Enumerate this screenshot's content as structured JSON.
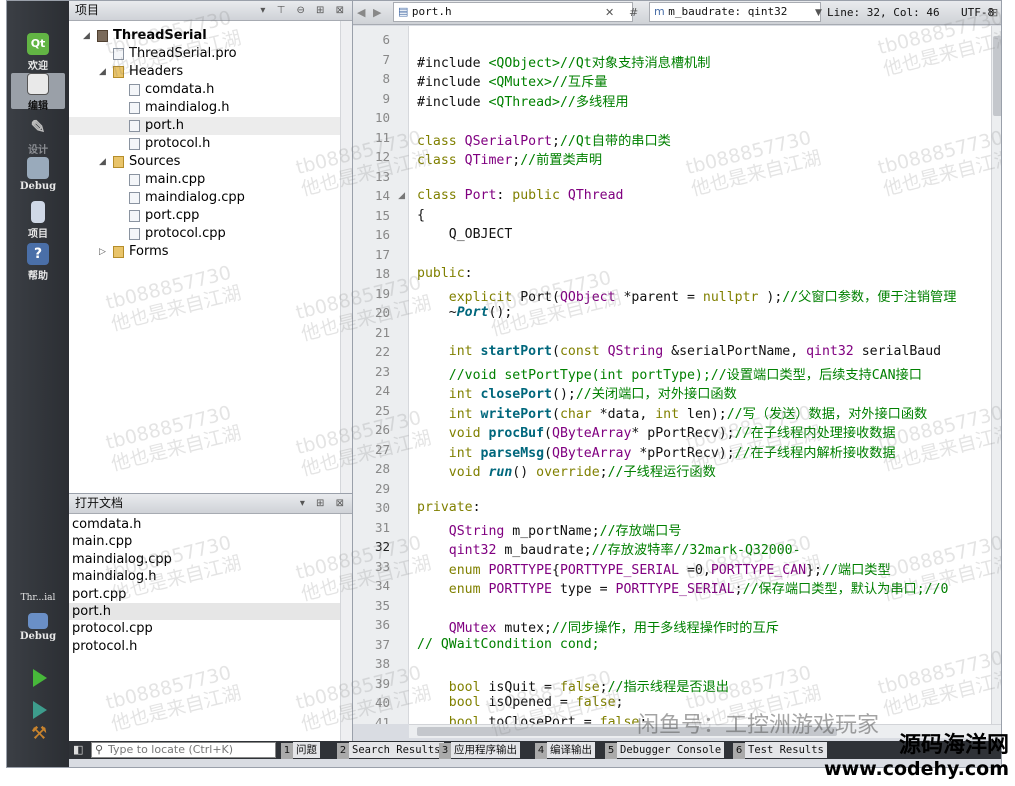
{
  "modes": [
    {
      "label": "欢迎",
      "icon": "qt-logo-icon",
      "icon_text": "Qt"
    },
    {
      "label": "编辑",
      "icon": "edit-document-icon",
      "active": true
    },
    {
      "label": "设计",
      "icon": "design-pen-icon"
    },
    {
      "label": "Debug",
      "icon": "debug-bug-icon"
    },
    {
      "label": "项目",
      "icon": "project-wrench-icon"
    },
    {
      "label": "帮助",
      "icon": "help-icon",
      "icon_text": "?"
    }
  ],
  "kit": {
    "label": "Thr...ial",
    "config": "Debug"
  },
  "project_pane": {
    "title": "项目",
    "tree": [
      {
        "label": "ThreadSerial",
        "level": 0,
        "expanded": true,
        "kind": "project"
      },
      {
        "label": "ThreadSerial.pro",
        "level": 1,
        "kind": "file"
      },
      {
        "label": "Headers",
        "level": 1,
        "expanded": true,
        "kind": "folder"
      },
      {
        "label": "comdata.h",
        "level": 2,
        "kind": "file"
      },
      {
        "label": "maindialog.h",
        "level": 2,
        "kind": "file"
      },
      {
        "label": "port.h",
        "level": 2,
        "kind": "file",
        "selected": true
      },
      {
        "label": "protocol.h",
        "level": 2,
        "kind": "file"
      },
      {
        "label": "Sources",
        "level": 1,
        "expanded": true,
        "kind": "folder"
      },
      {
        "label": "main.cpp",
        "level": 2,
        "kind": "file"
      },
      {
        "label": "maindialog.cpp",
        "level": 2,
        "kind": "file"
      },
      {
        "label": "port.cpp",
        "level": 2,
        "kind": "file"
      },
      {
        "label": "protocol.cpp",
        "level": 2,
        "kind": "file"
      },
      {
        "label": "Forms",
        "level": 1,
        "expanded": false,
        "kind": "folder"
      }
    ]
  },
  "open_docs": {
    "title": "打开文档",
    "items": [
      "comdata.h",
      "main.cpp",
      "maindialog.cpp",
      "maindialog.h",
      "port.cpp",
      "port.h",
      "protocol.cpp",
      "protocol.h"
    ],
    "selected": "port.h"
  },
  "editor": {
    "file": "port.h",
    "symbol": "m_baudrate: qint32",
    "position": "Line: 32, Col: 46",
    "encoding": "UTF-8"
  },
  "code_lines": [
    {
      "n": "6",
      "segs": []
    },
    {
      "n": "7",
      "segs": [
        [
          "",
          "#include "
        ],
        [
          "str",
          "<QObject>"
        ],
        [
          "cm",
          "//Qt对象支持消息槽机制"
        ]
      ]
    },
    {
      "n": "8",
      "segs": [
        [
          "",
          "#include "
        ],
        [
          "str",
          "<QMutex>"
        ],
        [
          "cm",
          "//互斥量"
        ]
      ]
    },
    {
      "n": "9",
      "segs": [
        [
          "",
          "#include "
        ],
        [
          "str",
          "<QThread>"
        ],
        [
          "cm",
          "//多线程用"
        ]
      ]
    },
    {
      "n": "10",
      "segs": []
    },
    {
      "n": "11",
      "segs": [
        [
          "kw",
          "class "
        ],
        [
          "type",
          "QSerialPort"
        ],
        [
          "",
          ";"
        ],
        [
          "cm",
          "//Qt自带的串口类"
        ]
      ]
    },
    {
      "n": "12",
      "segs": [
        [
          "kw",
          "class "
        ],
        [
          "type",
          "QTimer"
        ],
        [
          "",
          ";"
        ],
        [
          "cm",
          "//前置类声明"
        ]
      ]
    },
    {
      "n": "13",
      "segs": []
    },
    {
      "n": "14",
      "fold": true,
      "segs": [
        [
          "kw",
          "class "
        ],
        [
          "type",
          "Port"
        ],
        [
          "",
          ": "
        ],
        [
          "kw",
          "public "
        ],
        [
          "type",
          "QThread"
        ]
      ]
    },
    {
      "n": "15",
      "segs": [
        [
          "",
          "{"
        ]
      ]
    },
    {
      "n": "16",
      "segs": [
        [
          "",
          "    Q_OBJECT"
        ]
      ]
    },
    {
      "n": "17",
      "segs": []
    },
    {
      "n": "18",
      "segs": [
        [
          "kw",
          "public"
        ],
        [
          "",
          ":"
        ]
      ]
    },
    {
      "n": "19",
      "segs": [
        [
          "",
          "    "
        ],
        [
          "kw",
          "explicit "
        ],
        [
          "",
          "Port("
        ],
        [
          "type",
          "QObject "
        ],
        [
          "",
          "*parent = "
        ],
        [
          "kw",
          "nullptr"
        ],
        [
          "",
          " );"
        ],
        [
          "cm",
          "//父窗口参数，便于注销管理"
        ]
      ]
    },
    {
      "n": "20",
      "segs": [
        [
          "",
          "    ~"
        ],
        [
          "fni",
          "Port"
        ],
        [
          "",
          "();"
        ]
      ]
    },
    {
      "n": "21",
      "segs": []
    },
    {
      "n": "22",
      "segs": [
        [
          "",
          "    "
        ],
        [
          "kw",
          "int "
        ],
        [
          "fn",
          "startPort"
        ],
        [
          "",
          "("
        ],
        [
          "kw",
          "const "
        ],
        [
          "type",
          "QString "
        ],
        [
          "",
          "&serialPortName, "
        ],
        [
          "type",
          "qint32 "
        ],
        [
          "",
          "serialBaud"
        ]
      ]
    },
    {
      "n": "23",
      "segs": [
        [
          "",
          "    "
        ],
        [
          "cm",
          "//void setPortType(int portType);//设置端口类型，后续支持CAN接口"
        ]
      ]
    },
    {
      "n": "24",
      "segs": [
        [
          "",
          "    "
        ],
        [
          "kw",
          "int "
        ],
        [
          "fn",
          "closePort"
        ],
        [
          "",
          "();"
        ],
        [
          "cm",
          "//关闭端口，对外接口函数"
        ]
      ]
    },
    {
      "n": "25",
      "segs": [
        [
          "",
          "    "
        ],
        [
          "kw",
          "int "
        ],
        [
          "fn",
          "writePort"
        ],
        [
          "",
          "("
        ],
        [
          "kw",
          "char "
        ],
        [
          "",
          "*data, "
        ],
        [
          "kw",
          "int "
        ],
        [
          "",
          "len);"
        ],
        [
          "cm",
          "//写（发送）数据，对外接口函数"
        ]
      ]
    },
    {
      "n": "26",
      "segs": [
        [
          "",
          "    "
        ],
        [
          "kw",
          "void "
        ],
        [
          "fn",
          "procBuf"
        ],
        [
          "",
          "("
        ],
        [
          "type",
          "QByteArray"
        ],
        [
          "",
          "* pPortRecv);"
        ],
        [
          "cm",
          "//在子线程内处理接收数据"
        ]
      ]
    },
    {
      "n": "27",
      "segs": [
        [
          "",
          "    "
        ],
        [
          "kw",
          "int "
        ],
        [
          "fn",
          "parseMsg"
        ],
        [
          "",
          "("
        ],
        [
          "type",
          "QByteArray "
        ],
        [
          "",
          "*pPortRecv);"
        ],
        [
          "cm",
          "//在子线程内解析接收数据"
        ]
      ]
    },
    {
      "n": "28",
      "segs": [
        [
          "",
          "    "
        ],
        [
          "kw",
          "void "
        ],
        [
          "fni",
          "run"
        ],
        [
          "",
          "() "
        ],
        [
          "kw",
          "override"
        ],
        [
          "",
          ";"
        ],
        [
          "cm",
          "//子线程运行函数"
        ]
      ]
    },
    {
      "n": "29",
      "segs": []
    },
    {
      "n": "30",
      "segs": [
        [
          "kw",
          "private"
        ],
        [
          "",
          ":"
        ]
      ]
    },
    {
      "n": "31",
      "segs": [
        [
          "",
          "    "
        ],
        [
          "type",
          "QString "
        ],
        [
          "",
          "m_portName;"
        ],
        [
          "cm",
          "//存放端口号"
        ]
      ]
    },
    {
      "n": "32",
      "current": true,
      "segs": [
        [
          "",
          "    "
        ],
        [
          "type",
          "qint32 "
        ],
        [
          "",
          "m_baudrate;"
        ],
        [
          "cm",
          "//存放波特率//32mark-Q32000-"
        ]
      ]
    },
    {
      "n": "33",
      "segs": [
        [
          "",
          "    "
        ],
        [
          "kw",
          "enum "
        ],
        [
          "type",
          "PORTTYPE"
        ],
        [
          "",
          "{"
        ],
        [
          "en",
          "PORTTYPE_SERIAL "
        ],
        [
          "",
          "=0,"
        ],
        [
          "en",
          "PORTTYPE_CAN"
        ],
        [
          "",
          "};"
        ],
        [
          "cm",
          "//端口类型"
        ]
      ]
    },
    {
      "n": "34",
      "segs": [
        [
          "",
          "    "
        ],
        [
          "kw",
          "enum "
        ],
        [
          "type",
          "PORTTYPE "
        ],
        [
          "",
          "type = "
        ],
        [
          "en",
          "PORTTYPE_SERIAL"
        ],
        [
          "",
          ";"
        ],
        [
          "cm",
          "//保存端口类型，默认为串口;//0"
        ]
      ]
    },
    {
      "n": "35",
      "segs": []
    },
    {
      "n": "36",
      "segs": [
        [
          "",
          "    "
        ],
        [
          "type",
          "QMutex "
        ],
        [
          "",
          "mutex;"
        ],
        [
          "cm",
          "//同步操作，用于多线程操作时的互斥"
        ]
      ]
    },
    {
      "n": "37",
      "segs": [
        [
          "cm",
          "// QWaitCondition cond;"
        ]
      ]
    },
    {
      "n": "38",
      "segs": []
    },
    {
      "n": "39",
      "segs": [
        [
          "",
          "    "
        ],
        [
          "kw",
          "bool "
        ],
        [
          "",
          "isQuit = "
        ],
        [
          "kw",
          "false"
        ],
        [
          "",
          ";"
        ],
        [
          "cm",
          "//指示线程是否退出"
        ]
      ]
    },
    {
      "n": "40",
      "segs": [
        [
          "",
          "    "
        ],
        [
          "kw",
          "bool "
        ],
        [
          "",
          "isOpened = "
        ],
        [
          "kw",
          "false"
        ],
        [
          "",
          ";"
        ]
      ]
    },
    {
      "n": "41",
      "segs": [
        [
          "",
          "    "
        ],
        [
          "kw",
          "bool "
        ],
        [
          "",
          "toClosePort = "
        ],
        [
          "kw",
          "false"
        ],
        [
          "",
          ";"
        ]
      ]
    }
  ],
  "statusbar": {
    "locate_placeholder": "Type to locate (Ctrl+K)",
    "panes": [
      {
        "num": "1",
        "label": "问题"
      },
      {
        "num": "2",
        "label": "Search Results"
      },
      {
        "num": "3",
        "label": "应用程序输出"
      },
      {
        "num": "4",
        "label": "编译输出"
      },
      {
        "num": "5",
        "label": "Debugger Console"
      },
      {
        "num": "6",
        "label": "Test Results"
      }
    ]
  },
  "watermark": {
    "line1": "tb088857730",
    "line2": "他也是来自江湖"
  },
  "banner": "闲鱼号：工控洲游戏玩家",
  "site": {
    "cn": "源码海洋网",
    "url": "www.codehy.com"
  }
}
